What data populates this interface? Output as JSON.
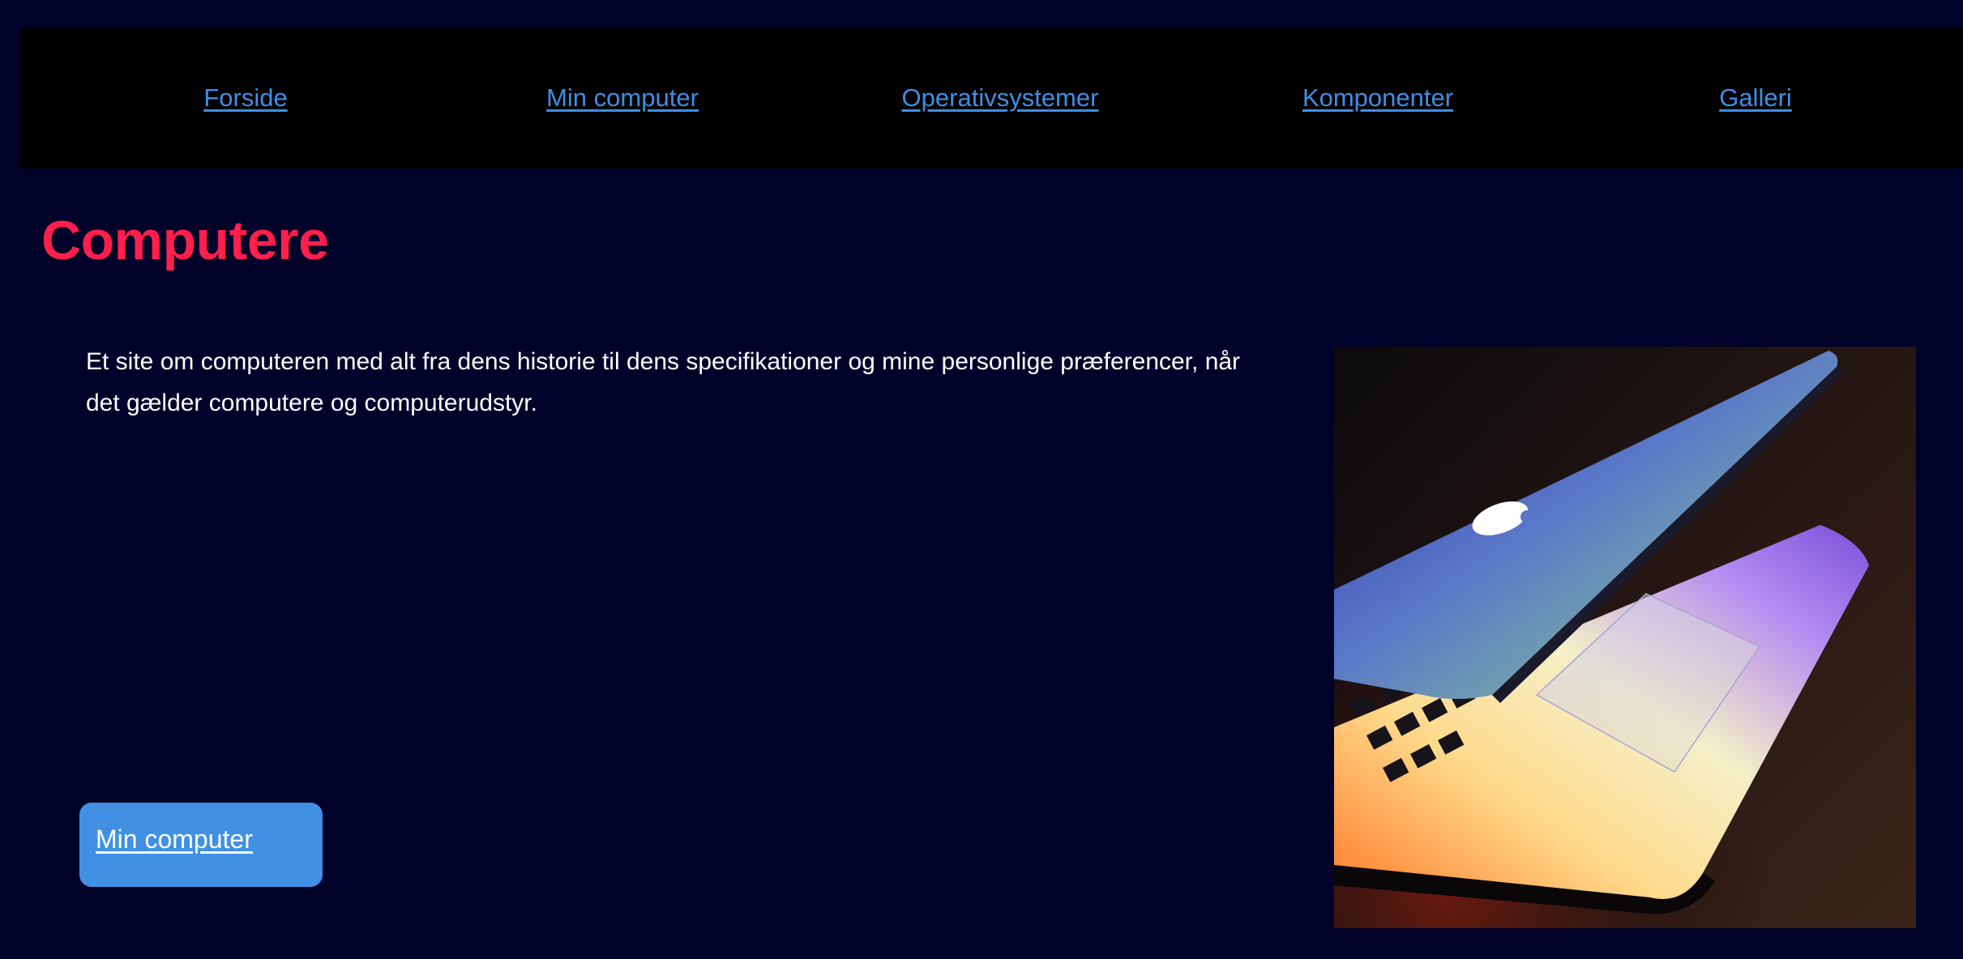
{
  "nav": {
    "items": [
      {
        "label": "Forside"
      },
      {
        "label": "Min computer"
      },
      {
        "label": "Operativsystemer"
      },
      {
        "label": "Komponenter"
      },
      {
        "label": "Galleri"
      }
    ]
  },
  "main": {
    "title": "Computere",
    "intro": "Et site om computeren med alt fra dens historie til dens specifikationer og mine personlige præferencer, når det gælder computere og computerudstyr.",
    "button_label": "Min computer"
  },
  "colors": {
    "page_background": "#00022a",
    "nav_background": "#000000",
    "link": "#3f8ee4",
    "title": "#ff1f4b",
    "button": "#4190e4"
  },
  "icons": {
    "logo": "apple-logo-icon"
  }
}
